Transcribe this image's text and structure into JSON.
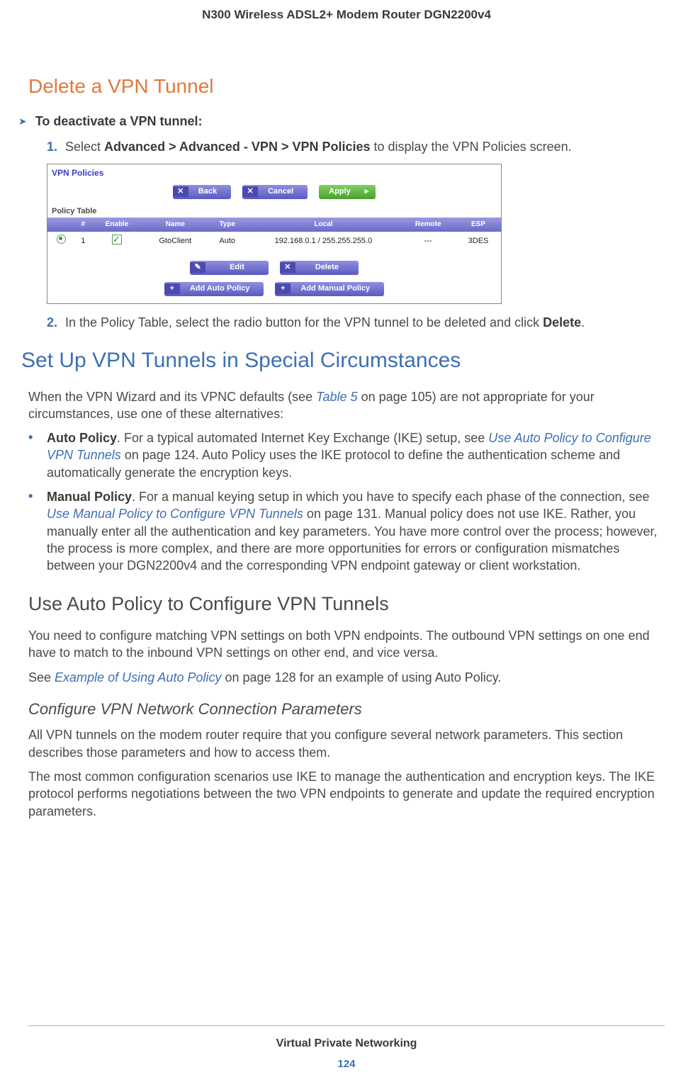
{
  "header": {
    "title": "N300 Wireless ADSL2+ Modem Router DGN2200v4"
  },
  "section_delete": {
    "heading": "Delete a VPN Tunnel",
    "proc_label": "To deactivate a VPN tunnel:",
    "step1_pre": "Select ",
    "step1_bold": "Advanced > Advanced - VPN > VPN Policies",
    "step1_post": " to display the VPN Policies screen.",
    "step2_pre": "In the Policy Table, select the radio button for the VPN tunnel to be deleted and click ",
    "step2_bold": "Delete",
    "step2_post": "."
  },
  "screenshot": {
    "title": "VPN Policies",
    "buttons_top": {
      "back": "Back",
      "cancel": "Cancel",
      "apply": "Apply"
    },
    "table_caption": "Policy Table",
    "columns": [
      "#",
      "Enable",
      "Name",
      "Type",
      "Local",
      "Remote",
      "ESP"
    ],
    "row": {
      "num": "1",
      "name": "GtoClient",
      "type": "Auto",
      "local": "192.168.0.1 / 255.255.255.0",
      "remote": "---",
      "esp": "3DES"
    },
    "buttons_mid": {
      "edit": "Edit",
      "delete": "Delete"
    },
    "buttons_bottom": {
      "add_auto": "Add Auto Policy",
      "add_manual": "Add Manual Policy"
    }
  },
  "section_setup": {
    "heading": "Set Up VPN Tunnels in Special Circumstances",
    "intro_pre": "When the VPN Wizard and its VPNC defaults (see ",
    "intro_link": "Table 5",
    "intro_post": " on page 105) are not appropriate for your circumstances, use one of these alternatives:",
    "bullet1_bold": "Auto Policy",
    "bullet1_a": ". For a typical automated Internet Key Exchange (IKE) setup, see ",
    "bullet1_link": "Use Auto Policy to Configure VPN Tunnels",
    "bullet1_b": " on page 124. Auto Policy uses the IKE protocol to define the authentication scheme and automatically generate the encryption keys.",
    "bullet2_bold": "Manual Policy",
    "bullet2_a": ". For a manual keying setup in which you have to specify each phase of the connection, see ",
    "bullet2_link": "Use Manual Policy to Configure VPN Tunnels",
    "bullet2_b": " on page 131. Manual policy does not use IKE. Rather, you manually enter all the authentication and key parameters. You have more control over the process; however, the process is more complex, and there are more opportunities for errors or configuration mismatches between your DGN2200v4 and the corresponding VPN endpoint gateway or client workstation."
  },
  "section_auto": {
    "heading": "Use Auto Policy to Configure VPN Tunnels",
    "p1": "You need to configure matching VPN settings on both VPN endpoints. The outbound VPN settings on one end have to match to the inbound VPN settings on other end, and vice versa.",
    "p2_pre": "See ",
    "p2_link": "Example of Using Auto Policy",
    "p2_post": " on page 128 for an example of using Auto Policy."
  },
  "section_params": {
    "heading": "Configure VPN Network Connection Parameters",
    "p1": "All VPN tunnels on the modem router require that you configure several network parameters. This section describes those parameters and how to access them.",
    "p2": "The most common configuration scenarios use IKE to manage the authentication and encryption keys. The IKE protocol performs negotiations between the two VPN endpoints to generate and update the required encryption parameters."
  },
  "footer": {
    "chapter": "Virtual Private Networking",
    "page": "124"
  },
  "steps": {
    "one": "1.",
    "two": "2."
  },
  "glyphs": {
    "arrow": "➤",
    "bullet": "•",
    "x": "✕",
    "pencil": "✎",
    "plus": "+",
    "tri": "▸"
  }
}
